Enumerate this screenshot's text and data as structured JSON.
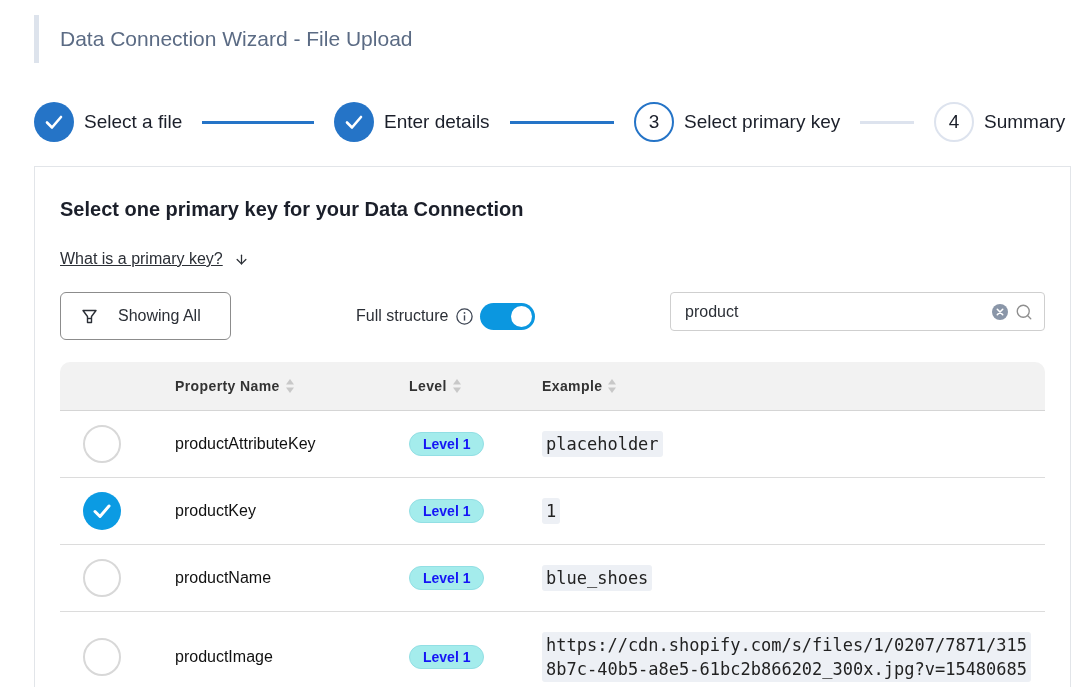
{
  "page": {
    "title": "Data Connection Wizard - File Upload"
  },
  "steps": [
    {
      "label": "Select a file",
      "done": true
    },
    {
      "label": "Enter details",
      "done": true
    },
    {
      "label": "Select primary key",
      "number": "3",
      "done": false
    },
    {
      "label": "Summary",
      "number": "4",
      "done": false
    }
  ],
  "panel": {
    "heading": "Select one primary key for your Data Connection",
    "help_link": "What is a primary key?",
    "filter_button": {
      "label": "Showing All"
    },
    "full_structure": {
      "label": "Full structure",
      "on": true
    },
    "search": {
      "value": "product"
    },
    "table": {
      "columns": [
        {
          "label": "Property Name"
        },
        {
          "label": "Level"
        },
        {
          "label": "Example"
        }
      ],
      "rows": [
        {
          "selected": false,
          "property_name": "productAttributeKey",
          "level_tag": "Level 1",
          "example": [
            "placeholder"
          ]
        },
        {
          "selected": true,
          "property_name": "productKey",
          "level_tag": "Level 1",
          "example": [
            "1"
          ]
        },
        {
          "selected": false,
          "property_name": "productName",
          "level_tag": "Level 1",
          "example": [
            "blue_shoes"
          ]
        },
        {
          "selected": false,
          "property_name": "productImage",
          "level_tag": "Level 1",
          "example": [
            "https://cdn.shopify.com/s/files/1/0207/7871/315",
            "8b7c-40b5-a8e5-61bc2b866202_300x.jpg?v=15480685"
          ]
        }
      ]
    }
  }
}
